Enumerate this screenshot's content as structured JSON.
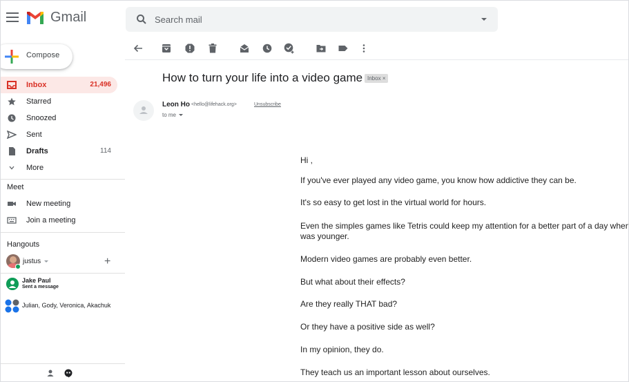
{
  "app": {
    "name": "Gmail"
  },
  "search": {
    "placeholder": "Search mail"
  },
  "compose": {
    "label": "Compose"
  },
  "nav": [
    {
      "label": "Inbox",
      "count": "21,496",
      "icon": "inbox-icon"
    },
    {
      "label": "Starred",
      "count": "",
      "icon": "star-icon"
    },
    {
      "label": "Snoozed",
      "count": "",
      "icon": "clock-icon"
    },
    {
      "label": "Sent",
      "count": "",
      "icon": "send-icon"
    },
    {
      "label": "Drafts",
      "count": "114",
      "icon": "draft-icon"
    },
    {
      "label": "More",
      "count": "",
      "icon": "chevron-down-icon"
    }
  ],
  "meet": {
    "title": "Meet",
    "items": [
      {
        "label": "New meeting",
        "icon": "video-icon"
      },
      {
        "label": "Join a meeting",
        "icon": "keyboard-icon"
      }
    ]
  },
  "hangouts": {
    "title": "Hangouts",
    "user": "justus",
    "contacts": [
      {
        "name": "Jake Paul",
        "sub": "Sent a message"
      }
    ],
    "group": {
      "name": "Julian, Gody, Veronica, Akachuk"
    }
  },
  "colors": {
    "accent": "#d93025",
    "active_bg": "#fce8e6",
    "online": "#0f9d58"
  },
  "email": {
    "subject": "How to turn your life into a video game",
    "label": "Inbox",
    "sender_name": "Leon Ho",
    "sender_email": "<hello@lifehack.org>",
    "unsubscribe": "Unsubscribe",
    "to": "to me",
    "body": [
      "Hi ,",
      "If you've ever played any video game, you know how addictive they can be.",
      "It's so easy to get lost in the virtual world for hours.",
      "Even the simples games like Tetris could keep my attention for a better part of a day when I",
      "was younger.",
      "Modern video games are probably even better.",
      "But what about their effects?",
      "Are they really THAT bad?",
      "Or they have a positive side as well?",
      "In my opinion, they do.",
      "They teach us an important lesson about ourselves."
    ]
  }
}
